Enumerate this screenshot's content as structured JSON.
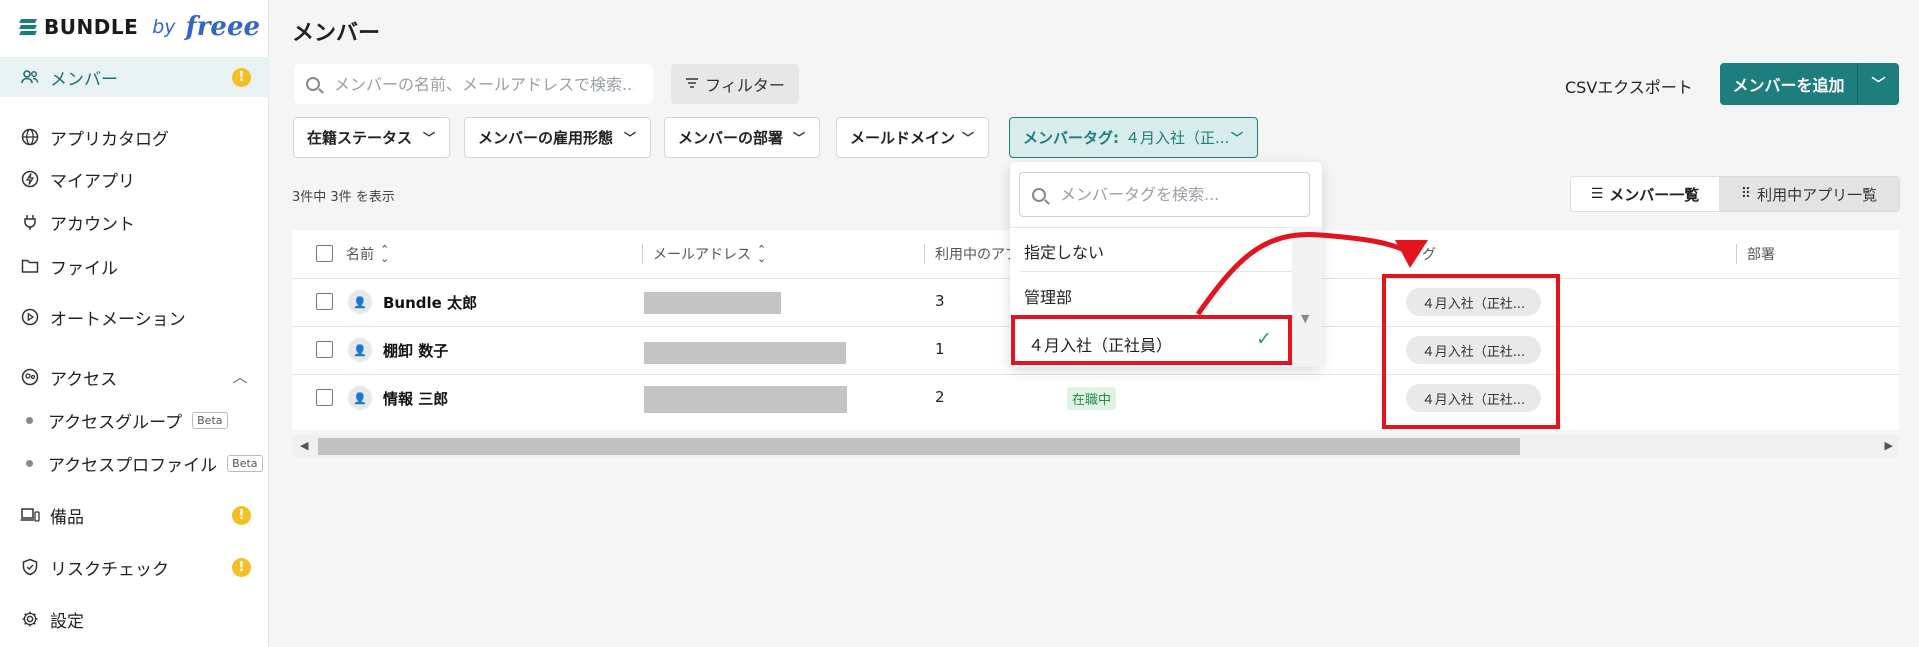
{
  "brand": {
    "name": "BUNDLE",
    "by": "by",
    "partner": "freee"
  },
  "page": {
    "title": "メンバー"
  },
  "sidebar": {
    "items": [
      {
        "label": "メンバー",
        "icon": "members-icon"
      },
      {
        "label": "アプリカタログ",
        "icon": "globe-icon"
      },
      {
        "label": "マイアプリ",
        "icon": "bolt-icon"
      },
      {
        "label": "アカウント",
        "icon": "plug-icon"
      },
      {
        "label": "ファイル",
        "icon": "folder-icon"
      },
      {
        "label": "オートメーション",
        "icon": "play-circle-icon"
      },
      {
        "label": "アクセス",
        "icon": "access-icon"
      },
      {
        "label": "備品",
        "icon": "devices-icon"
      },
      {
        "label": "リスクチェック",
        "icon": "shield-check-icon"
      },
      {
        "label": "設定",
        "icon": "gear-icon"
      }
    ],
    "sub_items": [
      {
        "label": "アクセスグループ",
        "badge": "Beta"
      },
      {
        "label": "アクセスプロファイル",
        "badge": "Beta"
      }
    ]
  },
  "toolbar": {
    "search_placeholder": "メンバーの名前、メールアドレスで検索...",
    "filter_label": "フィルター",
    "csv_export_label": "CSVエクスポート",
    "add_member_label": "メンバーを追加"
  },
  "filters": [
    {
      "label": "在籍ステータス"
    },
    {
      "label": "メンバーの雇用形態"
    },
    {
      "label": "メンバーの部署"
    },
    {
      "label": "メールドメイン"
    },
    {
      "label": "メンバータグ:",
      "value": "４月入社（正..."
    }
  ],
  "result_count": "3件中 3件 を表示",
  "view_toggle": {
    "list_label": "メンバー一覧",
    "apps_label": "利用中アプリ一覧"
  },
  "table": {
    "headers": {
      "name": "名前",
      "email": "メールアドレス",
      "apps": "利用中のアプ",
      "tag": "グ",
      "dept": "部署"
    },
    "rows": [
      {
        "name": "Bundle 太郎",
        "apps": "3",
        "status": "",
        "tag": "４月入社（正社..."
      },
      {
        "name": "棚卸 数子",
        "apps": "1",
        "status": "",
        "tag": "４月入社（正社..."
      },
      {
        "name": "情報 三郎",
        "apps": "2",
        "status": "在職中",
        "tag": "４月入社（正社..."
      }
    ]
  },
  "tag_dropdown": {
    "search_placeholder": "メンバータグを検索...",
    "options": [
      {
        "label": "指定しない",
        "selected": false
      },
      {
        "label": "管理部",
        "selected": false
      },
      {
        "label": "４月入社（正社員）",
        "selected": true
      }
    ]
  },
  "colors": {
    "accent": "#1e7d7d",
    "annotation": "#e3141d",
    "warning": "#f5bf23"
  }
}
